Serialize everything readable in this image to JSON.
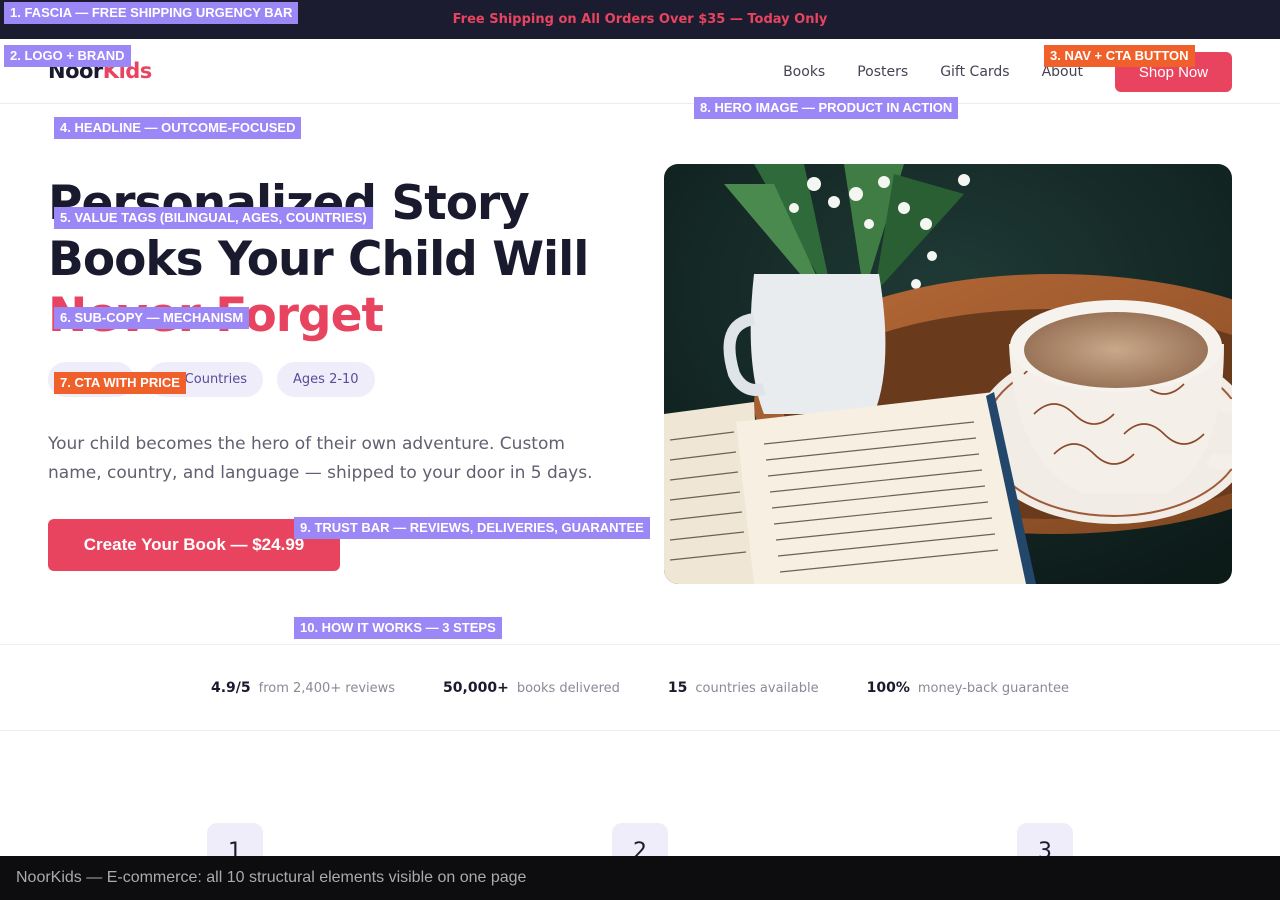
{
  "fascia": {
    "text": "Free Shipping on All Orders Over $35 — Today Only"
  },
  "logo": {
    "part1": "Noor",
    "part2": "Kids"
  },
  "nav": {
    "links": [
      "Books",
      "Posters",
      "Gift Cards",
      "About"
    ],
    "cta": "Shop Now"
  },
  "hero": {
    "headline_line1": "Personalized Story",
    "headline_line2": "Books Your Child Will",
    "headline_accent": "Never Forget",
    "tags": [
      "",
      "15 Countries",
      "Ages 2-10"
    ],
    "subcopy": "Your child becomes the hero of their own adventure. Custom name, country, and language — shipped to your door in 5 days.",
    "cta": "Create Your Book — $24.99"
  },
  "trust": [
    {
      "value": "4.9/5",
      "label": "from 2,400+ reviews"
    },
    {
      "value": "50,000+",
      "label": "books delivered"
    },
    {
      "value": "15",
      "label": "countries available"
    },
    {
      "value": "100%",
      "label": "money-back guarantee"
    }
  ],
  "steps": [
    "1",
    "2",
    "3"
  ],
  "annotations": [
    "1. FASCIA — FREE SHIPPING URGENCY BAR",
    "2. LOGO + BRAND",
    "3. NAV + CTA BUTTON",
    "4. HEADLINE — OUTCOME-FOCUSED",
    "5. VALUE TAGS (BILINGUAL, AGES, COUNTRIES)",
    "6. SUB-COPY — MECHANISM",
    "7. CTA WITH PRICE",
    "8. HERO IMAGE — PRODUCT IN ACTION",
    "9. TRUST BAR — REVIEWS, DELIVERIES, GUARANTEE",
    "10. HOW IT WORKS — 3 STEPS"
  ],
  "footer": {
    "caption": "NoorKids — E-commerce: all 10 structural elements visible on one page"
  },
  "colors": {
    "accent": "#e8445f",
    "dark": "#1c1c30",
    "tag_bg": "#f0edfb",
    "annotation": "#9b87f5",
    "annotation_alt": "#f0602a"
  }
}
